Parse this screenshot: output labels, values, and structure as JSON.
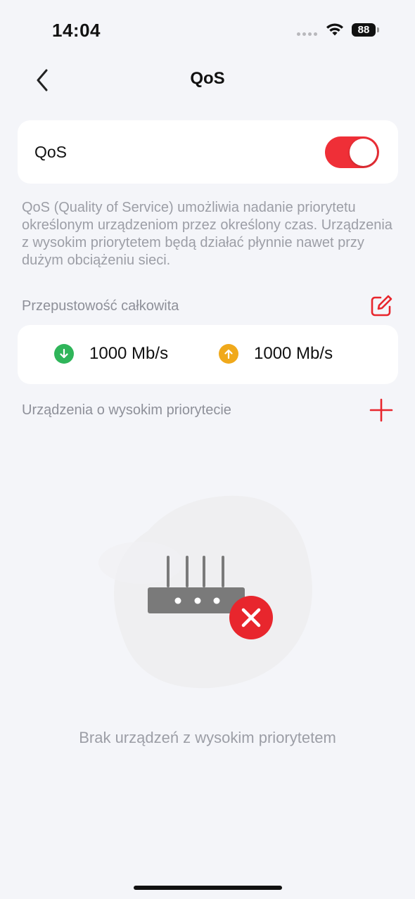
{
  "status_bar": {
    "time": "14:04",
    "battery": "88"
  },
  "nav": {
    "title": "QoS",
    "back_icon": "chevron-left-icon"
  },
  "qos_card": {
    "label": "QoS",
    "enabled": true,
    "toggle_color": "#ef2f37"
  },
  "description": "QoS (Quality of Service) umożliwia nadanie priorytetu określonym urządzeniom przez określony czas. Urządzenia z wysokim priorytetem będą działać płynnie nawet przy dużym obciążeniu sieci.",
  "bandwidth": {
    "section_label": "Przepustowość całkowita",
    "edit_icon": "edit-icon",
    "download": {
      "icon": "arrow-down-icon",
      "color": "#2fb55a",
      "value": "1000 Mb/s"
    },
    "upload": {
      "icon": "arrow-up-icon",
      "color": "#f0a91b",
      "value": "1000 Mb/s"
    }
  },
  "devices": {
    "section_label": "Urządzenia o wysokim priorytecie",
    "add_icon": "plus-icon",
    "empty_text": "Brak urządzeń z wysokim priorytetem"
  },
  "colors": {
    "accent": "#e8262d",
    "background": "#f4f5f9"
  }
}
